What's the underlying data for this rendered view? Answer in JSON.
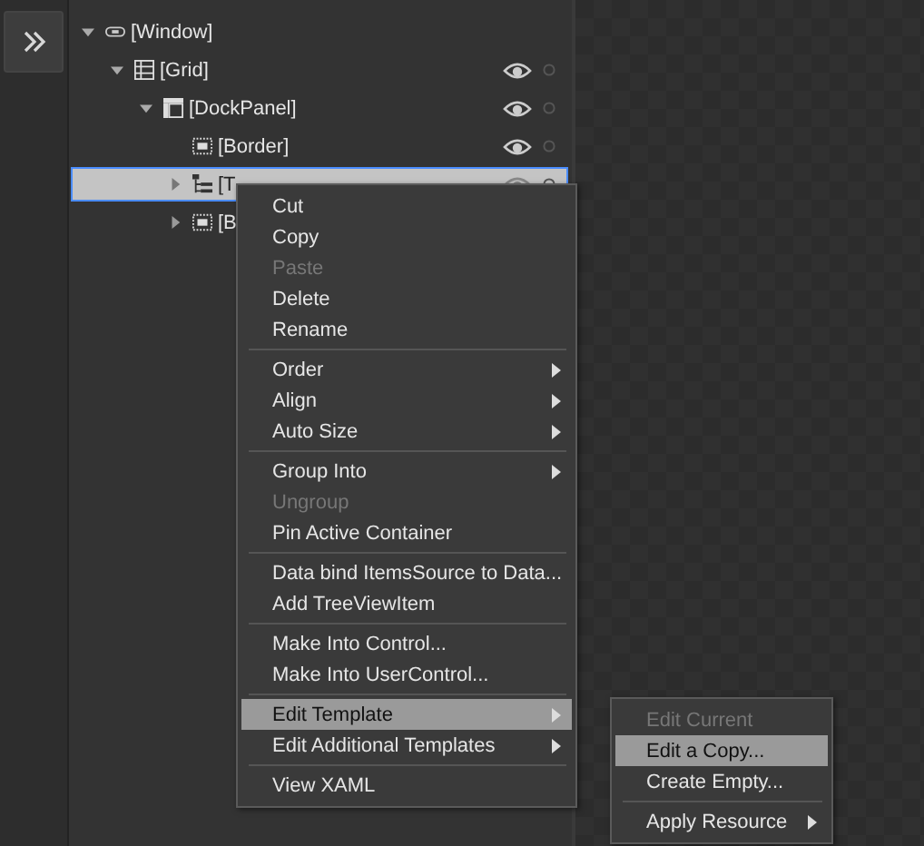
{
  "tree": [
    {
      "label": "[Window]",
      "kind": "window",
      "expanded": true,
      "selected": false,
      "eye": false,
      "children": [
        {
          "label": "[Grid]",
          "kind": "grid",
          "expanded": true,
          "selected": false,
          "eye": true,
          "children": [
            {
              "label": "[DockPanel]",
              "kind": "dockpanel",
              "expanded": true,
              "selected": false,
              "eye": true,
              "children": [
                {
                  "label": "[Border]",
                  "kind": "border",
                  "expanded": false,
                  "selected": false,
                  "eye": true
                },
                {
                  "label": "[T",
                  "kind": "treeview",
                  "expanded": false,
                  "selected": true,
                  "eye": true,
                  "expandable": true
                },
                {
                  "label": "[B",
                  "kind": "border",
                  "expanded": false,
                  "selected": false,
                  "eye": false,
                  "expandable": true
                }
              ]
            }
          ]
        }
      ]
    }
  ],
  "context_menu": {
    "groups": [
      [
        {
          "label": "Cut",
          "disabled": false,
          "submenu": false,
          "selected": false
        },
        {
          "label": "Copy",
          "disabled": false,
          "submenu": false,
          "selected": false
        },
        {
          "label": "Paste",
          "disabled": true,
          "submenu": false,
          "selected": false
        },
        {
          "label": "Delete",
          "disabled": false,
          "submenu": false,
          "selected": false
        },
        {
          "label": "Rename",
          "disabled": false,
          "submenu": false,
          "selected": false
        }
      ],
      [
        {
          "label": "Order",
          "disabled": false,
          "submenu": true,
          "selected": false
        },
        {
          "label": "Align",
          "disabled": false,
          "submenu": true,
          "selected": false
        },
        {
          "label": "Auto Size",
          "disabled": false,
          "submenu": true,
          "selected": false
        }
      ],
      [
        {
          "label": "Group Into",
          "disabled": false,
          "submenu": true,
          "selected": false
        },
        {
          "label": "Ungroup",
          "disabled": true,
          "submenu": false,
          "selected": false
        },
        {
          "label": "Pin Active Container",
          "disabled": false,
          "submenu": false,
          "selected": false
        }
      ],
      [
        {
          "label": "Data bind ItemsSource to Data...",
          "disabled": false,
          "submenu": false,
          "selected": false
        },
        {
          "label": "Add TreeViewItem",
          "disabled": false,
          "submenu": false,
          "selected": false
        }
      ],
      [
        {
          "label": "Make Into Control...",
          "disabled": false,
          "submenu": false,
          "selected": false
        },
        {
          "label": "Make Into UserControl...",
          "disabled": false,
          "submenu": false,
          "selected": false
        }
      ],
      [
        {
          "label": "Edit Template",
          "disabled": false,
          "submenu": true,
          "selected": true
        },
        {
          "label": "Edit Additional Templates",
          "disabled": false,
          "submenu": true,
          "selected": false
        }
      ],
      [
        {
          "label": "View XAML",
          "disabled": false,
          "submenu": false,
          "selected": false
        }
      ]
    ]
  },
  "submenu": {
    "groups": [
      [
        {
          "label": "Edit Current",
          "disabled": true,
          "submenu": false,
          "selected": false
        },
        {
          "label": "Edit a Copy...",
          "disabled": false,
          "submenu": false,
          "selected": true
        },
        {
          "label": "Create Empty...",
          "disabled": false,
          "submenu": false,
          "selected": false
        }
      ],
      [
        {
          "label": "Apply Resource",
          "disabled": false,
          "submenu": true,
          "selected": false
        }
      ]
    ]
  }
}
